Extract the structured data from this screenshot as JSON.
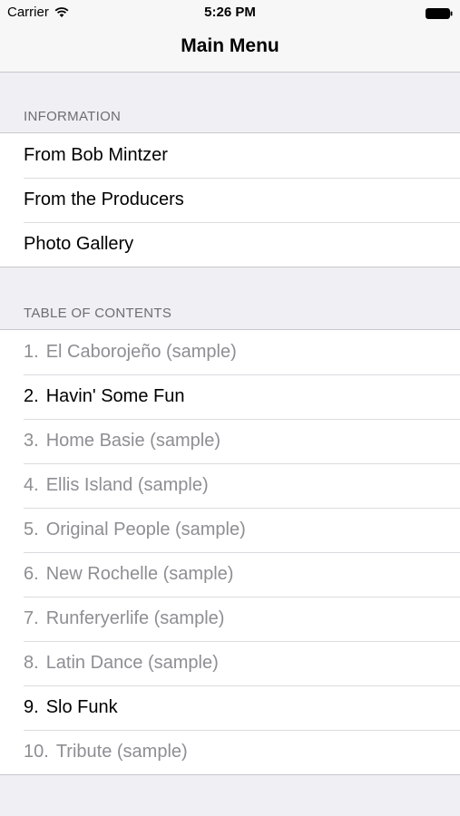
{
  "status_bar": {
    "carrier": "Carrier",
    "time": "5:26 PM",
    "wifi_icon": "wifi-icon",
    "battery_icon": "battery-full-icon"
  },
  "nav": {
    "title": "Main Menu"
  },
  "sections": {
    "information": {
      "header": "INFORMATION",
      "items": [
        {
          "label": "From Bob Mintzer"
        },
        {
          "label": "From the Producers"
        },
        {
          "label": "Photo Gallery"
        }
      ]
    },
    "toc": {
      "header": "TABLE OF CONTENTS",
      "items": [
        {
          "num": "1.",
          "label": "El Caborojeño (sample)",
          "enabled": false
        },
        {
          "num": "2.",
          "label": "Havin' Some Fun",
          "enabled": true
        },
        {
          "num": "3.",
          "label": "Home Basie (sample)",
          "enabled": false
        },
        {
          "num": "4.",
          "label": "Ellis Island (sample)",
          "enabled": false
        },
        {
          "num": "5.",
          "label": "Original People (sample)",
          "enabled": false
        },
        {
          "num": "6.",
          "label": "New Rochelle (sample)",
          "enabled": false
        },
        {
          "num": "7.",
          "label": "Runferyerlife (sample)",
          "enabled": false
        },
        {
          "num": "8.",
          "label": "Latin Dance (sample)",
          "enabled": false
        },
        {
          "num": "9.",
          "label": "Slo Funk",
          "enabled": true
        },
        {
          "num": "10.",
          "label": "Tribute (sample)",
          "enabled": false
        }
      ]
    }
  },
  "colors": {
    "background": "#efeff4",
    "row_background": "#ffffff",
    "section_header_text": "#6d6d72",
    "enabled_text": "#000000",
    "disabled_text": "#8e8e93"
  }
}
